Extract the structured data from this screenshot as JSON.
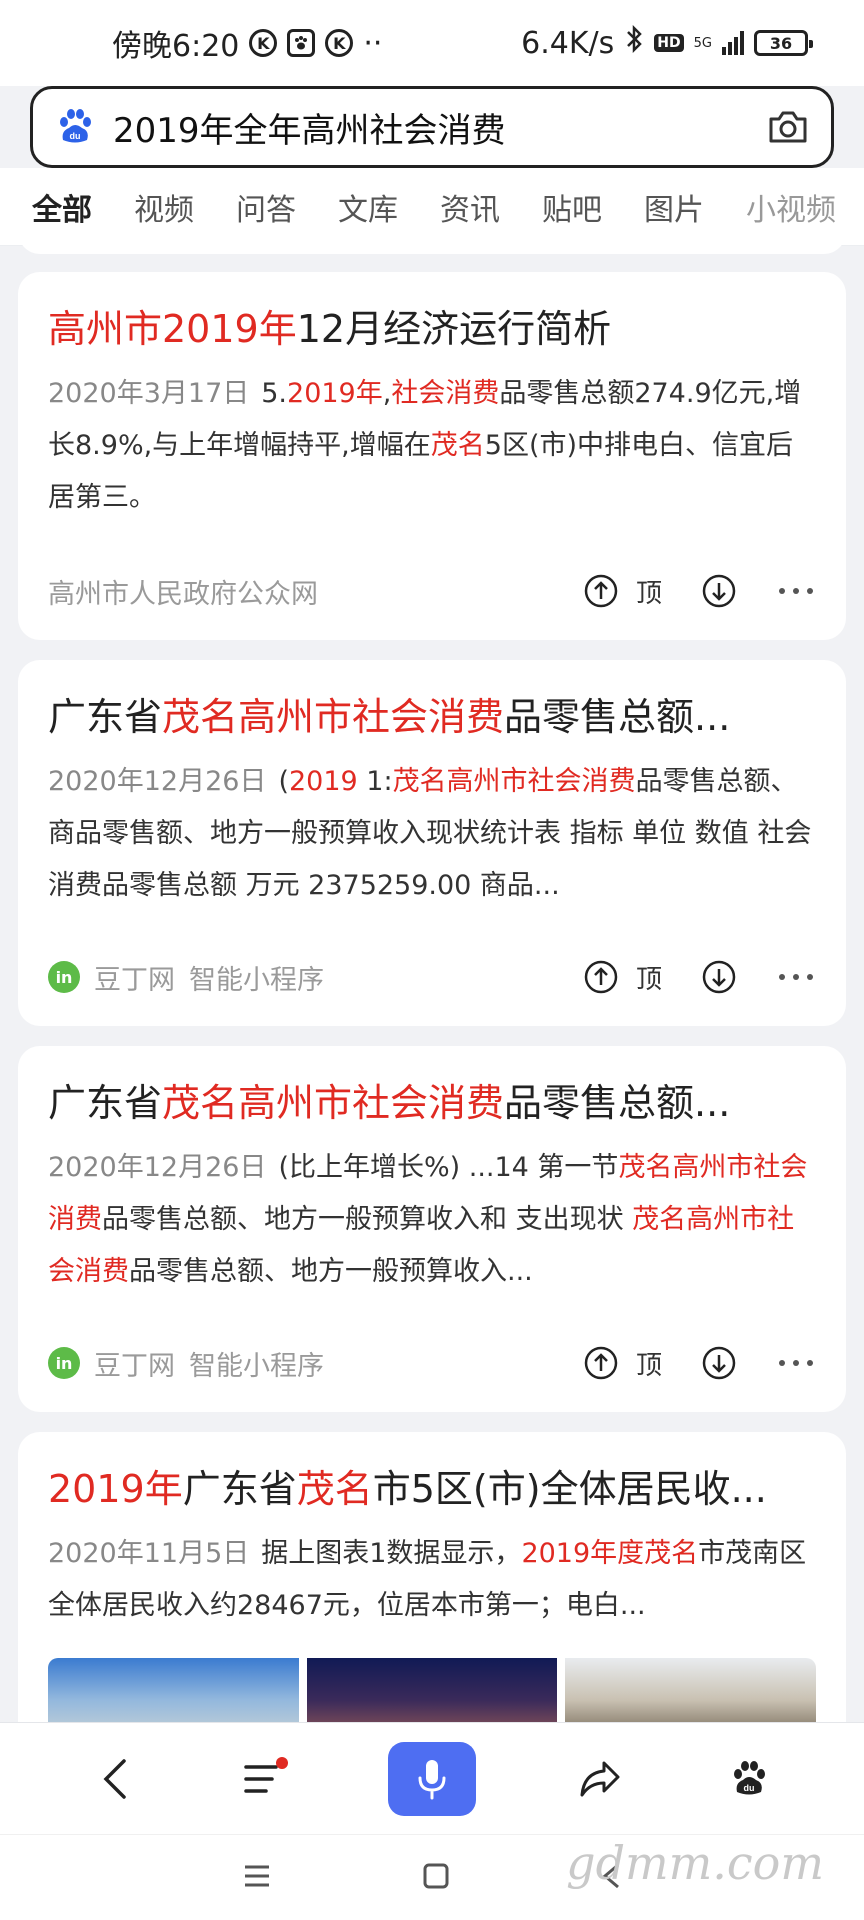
{
  "status_bar": {
    "time": "傍晚6:20",
    "k_badge": "K",
    "overflow": "··",
    "network_speed": "6.4K/s",
    "hd_label": "HD",
    "network_type": "5G",
    "battery": "36"
  },
  "search": {
    "query": "2019年全年高州社会消费"
  },
  "tabs": [
    "全部",
    "视频",
    "问答",
    "文库",
    "资讯",
    "贴吧",
    "图片",
    "小视频"
  ],
  "results": [
    {
      "title": [
        {
          "t": "高州市2019年",
          "hl": true
        },
        {
          "t": "12月经济运行简析",
          "hl": false
        }
      ],
      "date": "2020年3月17日",
      "abstract": [
        {
          "t": "5.",
          "hl": false
        },
        {
          "t": "2019年",
          "hl": true
        },
        {
          "t": ",",
          "hl": false
        },
        {
          "t": "社会消费",
          "hl": true
        },
        {
          "t": "品零售总额274.9亿元,增长8.9%,与上年增幅持平,增幅在",
          "hl": false
        },
        {
          "t": "茂名",
          "hl": true
        },
        {
          "t": "5区(市)中排电白、信宜后居第三。",
          "hl": false
        }
      ],
      "source": "高州市人民政府公众网",
      "source_logo": false,
      "top_label": "顶"
    },
    {
      "title": [
        {
          "t": "广东省",
          "hl": false
        },
        {
          "t": "茂名高州市社会消费",
          "hl": true
        },
        {
          "t": "品零售总额...",
          "hl": false
        }
      ],
      "date": "2020年12月26日",
      "abstract": [
        {
          "t": "(",
          "hl": false
        },
        {
          "t": "2019",
          "hl": true
        },
        {
          "t": " 1:",
          "hl": false
        },
        {
          "t": "茂名高州市社会消费",
          "hl": true
        },
        {
          "t": "品零售总额、商品零售额、地方一般预算收入现状统计表 指标 单位 数值 社会消费品零售总额 万元 2375259.00 商品...",
          "hl": false
        }
      ],
      "source": "豆丁网",
      "source_extra": "智能小程序",
      "source_logo": true,
      "source_logo_text": "in",
      "top_label": "顶"
    },
    {
      "title": [
        {
          "t": "广东省",
          "hl": false
        },
        {
          "t": "茂名高州市社会消费",
          "hl": true
        },
        {
          "t": "品零售总额...",
          "hl": false
        }
      ],
      "date": "2020年12月26日",
      "abstract": [
        {
          "t": "(比上年增长%) ...14 第一节",
          "hl": false
        },
        {
          "t": "茂名高州市社会消费",
          "hl": true
        },
        {
          "t": "品零售总额、地方一般预算收入和 支出现状 ",
          "hl": false
        },
        {
          "t": "茂名高州市社会消费",
          "hl": true
        },
        {
          "t": "品零售总额、地方一般预算收入...",
          "hl": false
        }
      ],
      "source": "豆丁网",
      "source_extra": "智能小程序",
      "source_logo": true,
      "source_logo_text": "in",
      "top_label": "顶"
    },
    {
      "title": [
        {
          "t": "2019年",
          "hl": true
        },
        {
          "t": "广东省",
          "hl": false
        },
        {
          "t": "茂名",
          "hl": true
        },
        {
          "t": "市5区(市)全体居民收...",
          "hl": false
        }
      ],
      "date": "2020年11月5日",
      "abstract": [
        {
          "t": "据上图表1数据显示，",
          "hl": false
        },
        {
          "t": "2019年度茂名",
          "hl": true
        },
        {
          "t": "市茂南区全体居民收入约28467元，位居本市第一；电白...",
          "hl": false
        }
      ]
    }
  ],
  "watermark": "gdmm.com",
  "colors": {
    "highlight": "#e02a22",
    "accent": "#4e6ef2",
    "tab_indicator": "#3862f5"
  }
}
